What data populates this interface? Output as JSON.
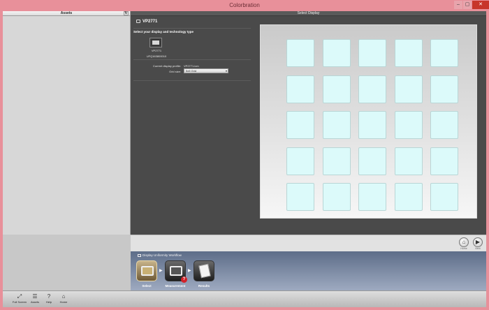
{
  "window": {
    "title": "Colorbration",
    "minimize": "–",
    "maximize": "▢",
    "close": "✕"
  },
  "assets": {
    "header": "Assets",
    "refresh": "↻"
  },
  "select_display": {
    "header": "Select Display",
    "display_name": "VP2771",
    "prompt": "Select your display and technology type",
    "monitor_name": "VP2771",
    "monitor_serial": "UFQ163800010",
    "profile_label": "Current display profile:",
    "profile_value": "VP2771.icm",
    "grid_label": "Grid size:",
    "grid_value": "5x5 Grid"
  },
  "preview": {
    "rows": 5,
    "cols": 5,
    "cell_color": "#dcfafa"
  },
  "nav": {
    "home_label": "Home",
    "next_label": "Next",
    "home_icon": "⌂",
    "next_icon": "▶"
  },
  "workflow": {
    "title": "Display Uniformity Workflow",
    "steps": [
      {
        "label": "Select",
        "state": "active"
      },
      {
        "label": "Measurement",
        "state": "pending",
        "badge": "?"
      },
      {
        "label": "Results",
        "state": "pending"
      }
    ],
    "arrow": "▶"
  },
  "toolbar": {
    "items": [
      {
        "label": "Full Screen",
        "icon": "⤢"
      },
      {
        "label": "Assets",
        "icon": "☰"
      },
      {
        "label": "Help",
        "icon": "?"
      },
      {
        "label": "Home",
        "icon": "⌂"
      }
    ]
  },
  "colors": {
    "titlebar": "#e8909a",
    "close": "#c7352b",
    "cell": "#dcfafa",
    "accent_badge": "#d2222a"
  }
}
